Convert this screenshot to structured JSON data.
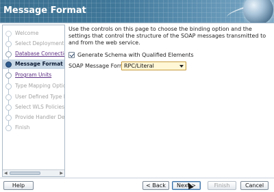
{
  "header": {
    "title": "Message Format"
  },
  "nav": {
    "items": [
      {
        "label": "Welcome",
        "state": "disabled"
      },
      {
        "label": "Select Deployment Platform",
        "state": "disabled"
      },
      {
        "label": "Database Connection",
        "state": "link"
      },
      {
        "label": "Message Format",
        "state": "active"
      },
      {
        "label": "Program Units",
        "state": "link"
      },
      {
        "label": "Type Mapping Options",
        "state": "disabled"
      },
      {
        "label": "User Defined Type Mappings",
        "state": "disabled"
      },
      {
        "label": "Select WLS Policies",
        "state": "disabled"
      },
      {
        "label": "Provide Handler Details",
        "state": "disabled"
      },
      {
        "label": "Finish",
        "state": "disabled"
      }
    ]
  },
  "main": {
    "description": "Use the controls on this page to choose the binding option and the settings that control the structure of the SOAP messages transmitted to and from the web service.",
    "generate_schema": {
      "label": "Generate Schema with Qualified Elements",
      "checked": true
    },
    "soap_format": {
      "label": "SOAP Message Format:",
      "value": "RPC/Literal"
    }
  },
  "footer": {
    "help": "Help",
    "back": "< Back",
    "next": "Next >",
    "finish": "Finish",
    "cancel": "Cancel"
  }
}
